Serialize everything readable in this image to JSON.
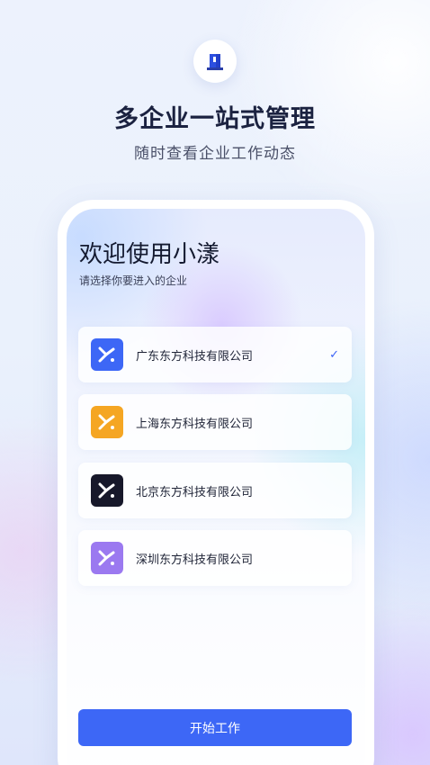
{
  "header": {
    "title": "多企业一站式管理",
    "subtitle": "随时查看企业工作动态",
    "app_icon": "building-icon"
  },
  "screen": {
    "welcome": "欢迎使用小漾",
    "prompt": "请选择你要进入的企业",
    "companies": [
      {
        "name": "广东东方科技有限公司",
        "logo_color": "#3d67f6",
        "selected": true
      },
      {
        "name": "上海东方科技有限公司",
        "logo_color": "#f5a623",
        "selected": false
      },
      {
        "name": "北京东方科技有限公司",
        "logo_color": "#17182a",
        "selected": false
      },
      {
        "name": "深圳东方科技有限公司",
        "logo_color": "#9b79f0",
        "selected": false
      }
    ],
    "check_glyph": "✓",
    "start_button": "开始工作"
  },
  "colors": {
    "accent": "#3d67f6",
    "title_text": "#1b2240"
  }
}
